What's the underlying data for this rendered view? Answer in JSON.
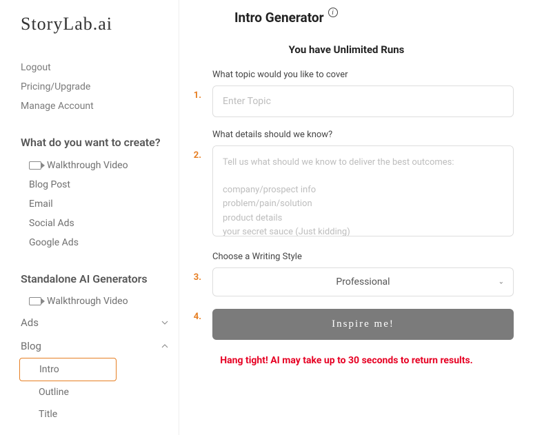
{
  "logo": "StoryLab.ai",
  "topLinks": [
    "Logout",
    "Pricing/Upgrade",
    "Manage Account"
  ],
  "section1": {
    "title": "What do you want to create?",
    "items": [
      "Walkthrough Video",
      "Blog Post",
      "Email",
      "Social Ads",
      "Google Ads"
    ]
  },
  "section2": {
    "title": "Standalone AI Generators",
    "walkthrough": "Walkthrough Video",
    "groups": [
      {
        "label": "Ads",
        "expanded": false
      },
      {
        "label": "Blog",
        "expanded": true,
        "children": [
          "Intro",
          "Outline",
          "Title"
        ],
        "activeIndex": 0
      }
    ]
  },
  "page": {
    "title": "Intro Generator",
    "runs_label": "You have Unlimited Runs",
    "step1": {
      "num": "1.",
      "label": "What topic would you like to cover",
      "placeholder": "Enter Topic"
    },
    "step2": {
      "num": "2.",
      "label": "What details should we know?",
      "placeholder": "Tell us what should we know to deliver the best outcomes:\n\ncompany/prospect info\nproblem/pain/solution\nproduct details\nyour secret sauce (Just kidding)"
    },
    "step3": {
      "num": "3.",
      "label": "Choose a Writing Style",
      "selected": "Professional"
    },
    "step4": {
      "num": "4.",
      "button": "Inspire me!"
    },
    "notice": "Hang tight! AI may take up to 30 seconds to return results."
  }
}
